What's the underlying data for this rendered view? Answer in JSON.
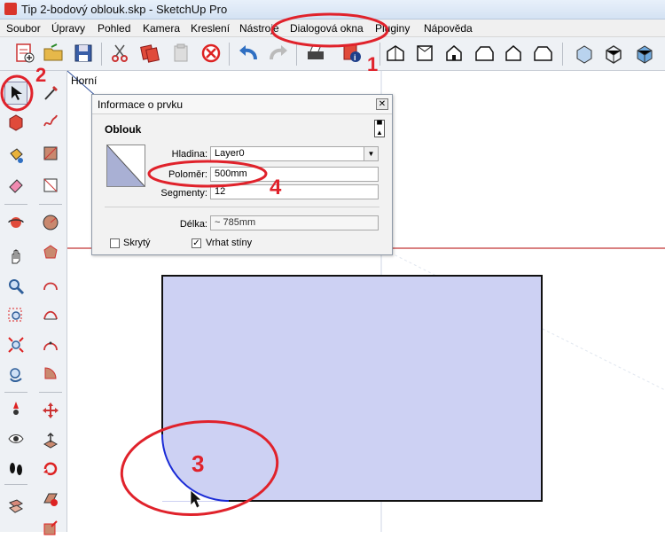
{
  "window": {
    "title": "Tip 2-bodový oblouk.skp - SketchUp Pro"
  },
  "menu": [
    "Soubor",
    "Úpravy",
    "Pohled",
    "Kamera",
    "Kreslení",
    "Nástroje",
    "Dialogová okna",
    "Pluginy",
    "Nápověda"
  ],
  "viewport": {
    "view_label": "Horní"
  },
  "entity_info": {
    "dialog_title": "Informace o prvku",
    "entity_type": "Oblouk",
    "layer_label": "Hladina:",
    "layer_value": "Layer0",
    "radius_label": "Poloměr:",
    "radius_value": "500mm",
    "segments_label": "Segmenty:",
    "segments_value": "12",
    "length_label": "Délka:",
    "length_value": "~ 785mm",
    "hidden_label": "Skrytý",
    "hidden_checked": false,
    "cast_shadows_label": "Vrhat stíny",
    "cast_shadows_checked": true
  },
  "annotations": {
    "n1": "1",
    "n2": "2",
    "n3": "3",
    "n4": "4"
  },
  "colors": {
    "annotation": "#e0222b",
    "face": "#cdd1f3",
    "arc": "#1a2bd6"
  }
}
